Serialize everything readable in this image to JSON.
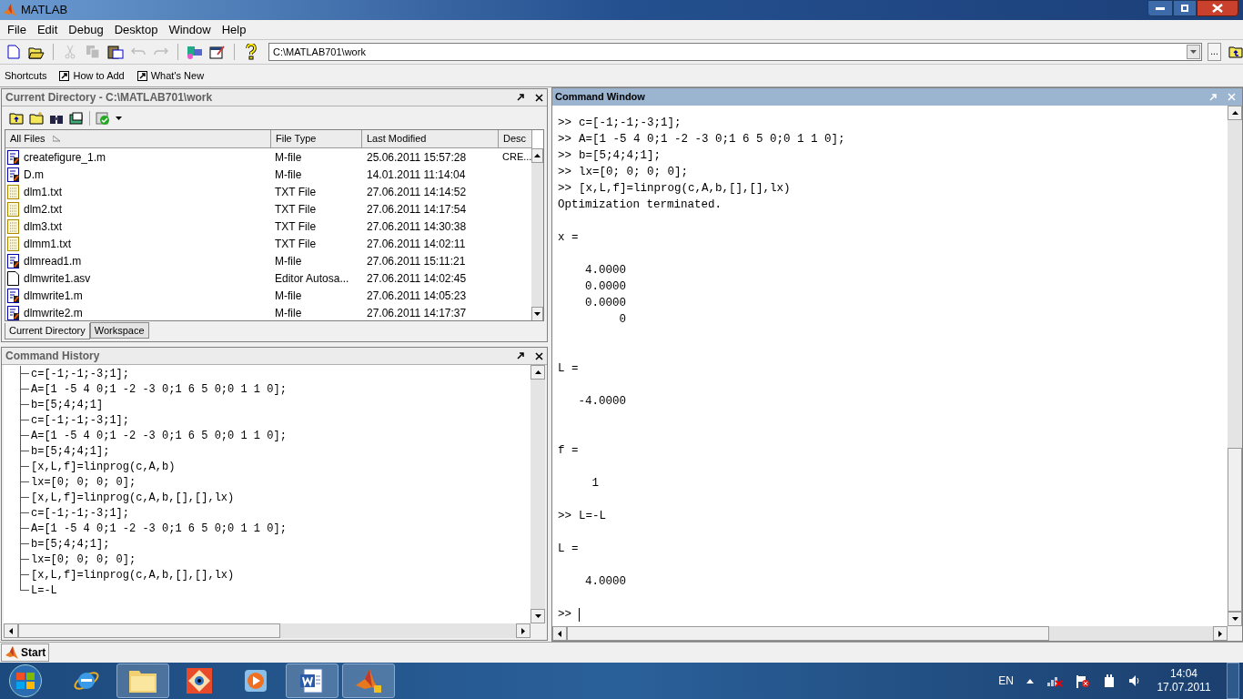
{
  "window": {
    "title": "MATLAB"
  },
  "menu": [
    "File",
    "Edit",
    "Debug",
    "Desktop",
    "Window",
    "Help"
  ],
  "toolbar": [
    {
      "kind": "new",
      "disabled": false
    },
    {
      "kind": "open",
      "disabled": false
    },
    {
      "kind": "cut",
      "disabled": true
    },
    {
      "kind": "copy",
      "disabled": true
    },
    {
      "kind": "paste",
      "disabled": false
    },
    {
      "kind": "undo",
      "disabled": true
    },
    {
      "kind": "redo",
      "disabled": true
    },
    {
      "kind": "simulink",
      "disabled": false
    },
    {
      "kind": "guide",
      "disabled": false
    },
    {
      "kind": "help",
      "disabled": false
    }
  ],
  "current_directory_field": {
    "value": "C:\\MATLAB701\\work",
    "browse_label": "..."
  },
  "shortcuts_bar": {
    "label": "Shortcuts",
    "items": [
      "How to Add",
      "What's New"
    ]
  },
  "current_directory": {
    "title": "Current Directory - C:\\MATLAB701\\work",
    "columns": [
      "All Files",
      "File Type",
      "Last Modified",
      "Desc"
    ],
    "rows": [
      {
        "kind": "m",
        "name": "createfigure_1.m",
        "type": "M-file",
        "modified": "25.06.2011 15:57:28",
        "desc": "CRE..."
      },
      {
        "kind": "m",
        "name": "D.m",
        "type": "M-file",
        "modified": "14.01.2011 11:14:04"
      },
      {
        "kind": "txt",
        "name": "dlm1.txt",
        "type": "TXT File",
        "modified": "27.06.2011 14:14:52"
      },
      {
        "kind": "txt",
        "name": "dlm2.txt",
        "type": "TXT File",
        "modified": "27.06.2011 14:17:54"
      },
      {
        "kind": "txt",
        "name": "dlm3.txt",
        "type": "TXT File",
        "modified": "27.06.2011 14:30:38"
      },
      {
        "kind": "txt",
        "name": "dlmm1.txt",
        "type": "TXT File",
        "modified": "27.06.2011 14:02:11"
      },
      {
        "kind": "m",
        "name": "dlmread1.m",
        "type": "M-file",
        "modified": "27.06.2011 15:11:21"
      },
      {
        "kind": "asv",
        "name": "dlmwrite1.asv",
        "type": "Editor Autosa...",
        "modified": "27.06.2011 14:02:45"
      },
      {
        "kind": "m",
        "name": "dlmwrite1.m",
        "type": "M-file",
        "modified": "27.06.2011 14:05:23"
      },
      {
        "kind": "m",
        "name": "dlmwrite2.m",
        "type": "M-file",
        "modified": "27.06.2011 14:17:37"
      }
    ],
    "tabs": [
      {
        "label": "Current Directory",
        "selected": true
      },
      {
        "label": "Workspace",
        "selected": false
      }
    ]
  },
  "command_history": {
    "title": "Command History",
    "entries": [
      "c=[-1;-1;-3;1];",
      "A=[1 -5 4 0;1 -2 -3 0;1 6 5 0;0 1 1 0];",
      "b=[5;4;4;1]",
      "c=[-1;-1;-3;1];",
      "A=[1 -5 4 0;1 -2 -3 0;1 6 5 0;0 1 1 0];",
      "b=[5;4;4;1];",
      "[x,L,f]=linprog(c,A,b)",
      "lx=[0; 0; 0; 0];",
      "[x,L,f]=linprog(c,A,b,[],[],lx)",
      "c=[-1;-1;-3;1];",
      "A=[1 -5 4 0;1 -2 -3 0;1 6 5 0;0 1 1 0];",
      "b=[5;4;4;1];",
      "lx=[0; 0; 0; 0];",
      "[x,L,f]=linprog(c,A,b,[],[],lx)",
      "L=-L"
    ]
  },
  "command_window": {
    "title": "Command Window",
    "entries": [
      {
        "kind": "command",
        "prompt": ">>",
        "text": "c=[-1;-1;-3;1];"
      },
      {
        "kind": "command",
        "prompt": ">>",
        "text": "A=[1 -5 4 0;1 -2 -3 0;1 6 5 0;0 1 1 0];"
      },
      {
        "kind": "command",
        "prompt": ">>",
        "text": "b=[5;4;4;1];"
      },
      {
        "kind": "command",
        "prompt": ">>",
        "text": "lx=[0; 0; 0; 0];"
      },
      {
        "kind": "command",
        "prompt": ">>",
        "text": "[x,L,f]=linprog(c,A,b,[],[],lx)"
      },
      {
        "kind": "message",
        "text": "Optimization terminated."
      },
      {
        "kind": "variable",
        "name": "x =",
        "values": [
          "    4.0000",
          "    0.0000",
          "    0.0000",
          "         0"
        ]
      },
      {
        "kind": "variable",
        "name": "L =",
        "values": [
          "   -4.0000"
        ]
      },
      {
        "kind": "variable",
        "name": "f =",
        "values": [
          "     1"
        ]
      },
      {
        "kind": "command",
        "prompt": ">>",
        "text": "L=-L"
      },
      {
        "kind": "variable",
        "name": "L =",
        "values": [
          "    4.0000"
        ]
      },
      {
        "kind": "input",
        "prompt": ">>"
      }
    ]
  },
  "start_button": {
    "label": "Start"
  },
  "taskbar": {
    "apps": [
      {
        "kind": "ie",
        "open": false
      },
      {
        "kind": "explorer",
        "open": true
      },
      {
        "kind": "viewer",
        "open": false
      },
      {
        "kind": "media",
        "open": false
      },
      {
        "kind": "word",
        "open": true
      },
      {
        "kind": "matlab",
        "open": true
      }
    ],
    "language": "EN",
    "time": "14:04",
    "date": "17.07.2011"
  }
}
